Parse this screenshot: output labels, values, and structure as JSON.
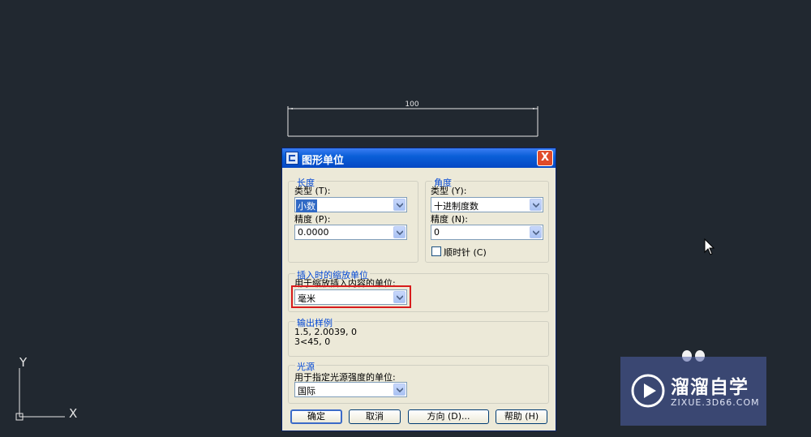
{
  "canvas": {
    "dimension_text": "100",
    "ucs_y_label": "Y",
    "ucs_x_label": "X"
  },
  "watermark": {
    "title": "溜溜自学",
    "subtitle": "ZIXUE.3D66.COM",
    "logo_icon": "play-icon"
  },
  "dialog": {
    "title": "图形单位",
    "close_label": "X",
    "length": {
      "legend": "长度",
      "type_label": "类型 (T):",
      "type_value": "小数",
      "precision_label": "精度 (P):",
      "precision_value": "0.0000"
    },
    "angle": {
      "legend": "角度",
      "type_label": "类型 (Y):",
      "type_value": "十进制度数",
      "precision_label": "精度 (N):",
      "precision_value": "0",
      "clockwise_label": "顺时针 (C)",
      "clockwise_checked": false
    },
    "insertion": {
      "legend": "插入时的缩放单位",
      "desc": "用于缩放插入内容的单位:",
      "value": "毫米"
    },
    "sample": {
      "legend": "输出样例",
      "line1": "1.5, 2.0039, 0",
      "line2": "3<45, 0"
    },
    "lighting": {
      "legend": "光源",
      "desc": "用于指定光源强度的单位:",
      "value": "国际"
    },
    "buttons": {
      "ok": "确定",
      "cancel": "取消",
      "direction": "方向 (D)...",
      "help": "帮助 (H)"
    }
  },
  "colors": {
    "background": "#212830",
    "title_bar": "#0548c4",
    "highlight": "#d81c1c",
    "group_legend": "#0046d5"
  }
}
